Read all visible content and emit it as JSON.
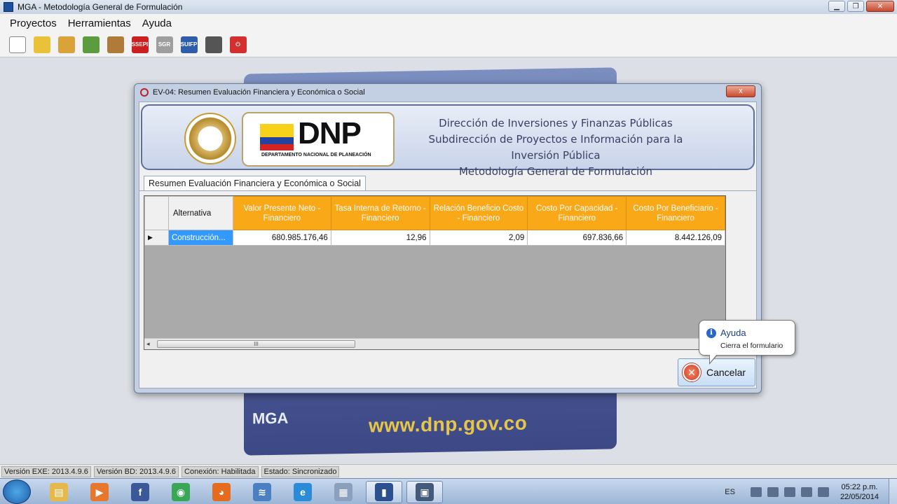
{
  "app": {
    "title": "MGA - Metodología General de Formulación"
  },
  "menu": [
    "Proyectos",
    "Herramientas",
    "Ayuda"
  ],
  "toolbar": {
    "buttons": [
      {
        "name": "new-document",
        "color": "#ffffff",
        "text": ""
      },
      {
        "name": "open-folder",
        "color": "#e9c23a",
        "text": ""
      },
      {
        "name": "delete",
        "color": "#d9a33a",
        "text": ""
      },
      {
        "name": "refresh",
        "color": "#5c9b3e",
        "text": ""
      },
      {
        "name": "transfer",
        "color": "#b07a3a",
        "text": ""
      },
      {
        "name": "ssepi",
        "color": "#cc1f1f",
        "text": "SSEPI"
      },
      {
        "name": "sgr",
        "color": "#9e9e9e",
        "text": "SGR"
      },
      {
        "name": "suifp",
        "color": "#2f5ea8",
        "text": "SUIFP"
      },
      {
        "name": "print",
        "color": "#555555",
        "text": ""
      },
      {
        "name": "exit",
        "color": "#d32f2f",
        "text": "⏻"
      }
    ]
  },
  "background": {
    "box_label": "MGA",
    "url": "www.dnp.gov.co"
  },
  "dialog": {
    "title": "EV-04: Resumen Evaluación Financiera y Económica o Social",
    "close_label": "x",
    "logo": {
      "text": "DNP",
      "subtitle": "DEPARTAMENTO NACIONAL DE PLANEACIÓN"
    },
    "header_lines": [
      "Dirección de Inversiones y Finanzas Públicas",
      "Subdirección de Proyectos e Información para la Inversión Pública",
      "Metodología General de Formulación"
    ],
    "tab_label": "Resumen Evaluación Financiera y Económica o Social",
    "table": {
      "columns": [
        "Alternativa",
        "Valor Presente Neto - Financiero",
        "Tasa Interna de Retorno - Financiero",
        "Relación Beneficio Costo - Financiero",
        "Costo Por Capacidad - Financiero",
        "Costo Por Beneficiario - Financiero"
      ],
      "rows": [
        [
          "Construcción...",
          "680.985.176,46",
          "12,96",
          "2,09",
          "697.836,66",
          "8.442.126,09"
        ]
      ],
      "header_color": "#f9a818"
    },
    "scrollbar_thumb_label": "III",
    "cancel_label": "Cancelar"
  },
  "tooltip": {
    "title": "Ayuda",
    "text": "Cierra el formulario"
  },
  "statusbar": [
    "Versión EXE: 2013.4.9.6",
    "Versión BD: 2013.4.9.6",
    "Conexión: Habilitada",
    "Estado: Sincronizado"
  ],
  "taskbar": {
    "apps": [
      {
        "name": "explorer",
        "color": "#e6b84a",
        "glyph": "▤",
        "active": false
      },
      {
        "name": "media-player",
        "color": "#e8772e",
        "glyph": "▶",
        "active": false
      },
      {
        "name": "facebook",
        "color": "#3b5998",
        "glyph": "f",
        "active": false
      },
      {
        "name": "chrome",
        "color": "#3aa757",
        "glyph": "◉",
        "active": false
      },
      {
        "name": "firefox",
        "color": "#e56b1f",
        "glyph": "◕",
        "active": false
      },
      {
        "name": "network",
        "color": "#4a7fc1",
        "glyph": "≋",
        "active": false
      },
      {
        "name": "internet-explorer",
        "color": "#2a8bd8",
        "glyph": "e",
        "active": false
      },
      {
        "name": "calculator",
        "color": "#8aa0bd",
        "glyph": "▦",
        "active": false
      },
      {
        "name": "mga-app",
        "color": "#2b4f8f",
        "glyph": "▮",
        "active": true
      },
      {
        "name": "video-editor",
        "color": "#445a7a",
        "glyph": "▣",
        "active": true
      }
    ],
    "language": "ES",
    "time": "05:22 p.m.",
    "date": "22/05/2014"
  }
}
